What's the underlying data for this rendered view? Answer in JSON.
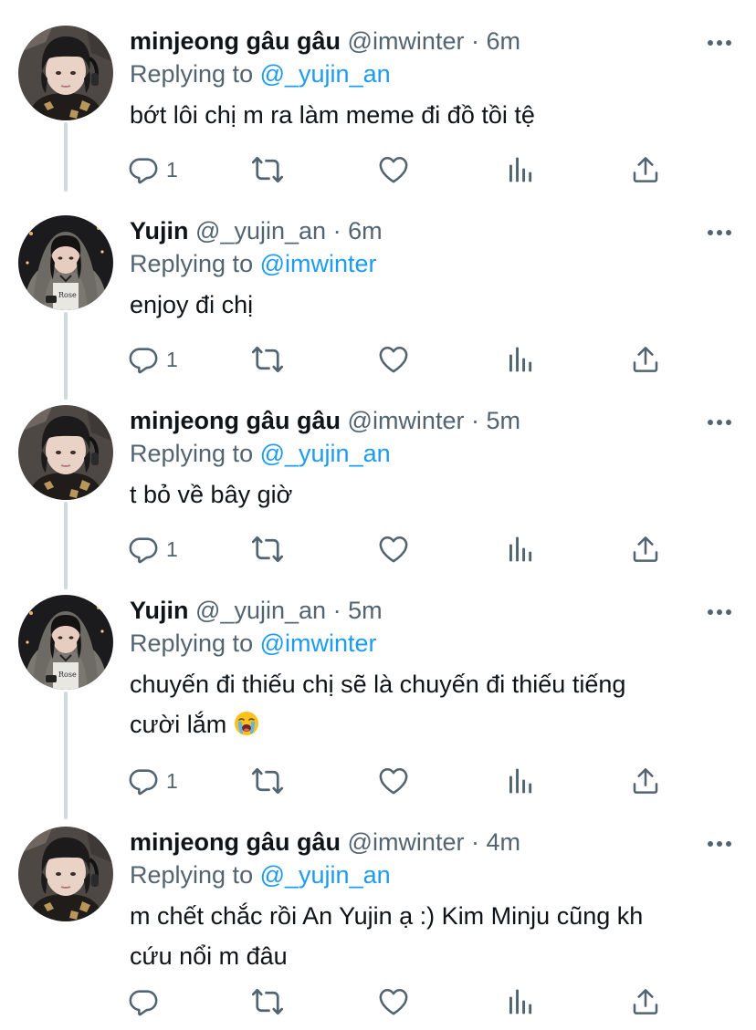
{
  "tweets": [
    {
      "name": "minjeong gâu gâu",
      "handle": "@imwinter",
      "sep": "·",
      "time": "6m",
      "replying_label": "Replying to",
      "replying_to": "@_yujin_an",
      "text": "bớt lôi chị m ra làm meme đi đồ tồi tệ",
      "reply_count": "1",
      "avatar_icon": "winter-profile-photo"
    },
    {
      "name": "Yujin",
      "handle": "@_yujin_an",
      "sep": "·",
      "time": "6m",
      "replying_label": "Replying to",
      "replying_to": "@imwinter",
      "text": "enjoy đi chị",
      "reply_count": "1",
      "avatar_icon": "yujin-profile-photo"
    },
    {
      "name": "minjeong gâu gâu",
      "handle": "@imwinter",
      "sep": "·",
      "time": "5m",
      "replying_label": "Replying to",
      "replying_to": "@_yujin_an",
      "text": "t bỏ về bây giờ",
      "reply_count": "1",
      "avatar_icon": "winter-profile-photo"
    },
    {
      "name": "Yujin",
      "handle": "@_yujin_an",
      "sep": "·",
      "time": "5m",
      "replying_label": "Replying to",
      "replying_to": "@imwinter",
      "text_line1": "chuyến đi thiếu chị sẽ là chuyến đi thiếu tiếng",
      "text_line2": "cười lắm",
      "text_emoji": "😭",
      "reply_count": "1",
      "avatar_icon": "yujin-profile-photo"
    },
    {
      "name": "minjeong gâu gâu",
      "handle": "@imwinter",
      "sep": "·",
      "time": "4m",
      "replying_label": "Replying to",
      "replying_to": "@_yujin_an",
      "text_line1": "m chết chắc rồi An Yujin ạ :) Kim Minju cũng kh",
      "text_line2": "cứu nổi m đâu",
      "reply_count": "",
      "avatar_icon": "winter-profile-photo"
    }
  ],
  "icons": {
    "reply": "reply-icon",
    "retweet": "retweet-icon",
    "like": "like-icon",
    "analytics": "analytics-icon",
    "share": "share-icon",
    "more": "more-icon"
  },
  "colors": {
    "text": "#0f1419",
    "secondary": "#536471",
    "link": "#1d9bf0",
    "thread_line": "#cfd9de"
  }
}
